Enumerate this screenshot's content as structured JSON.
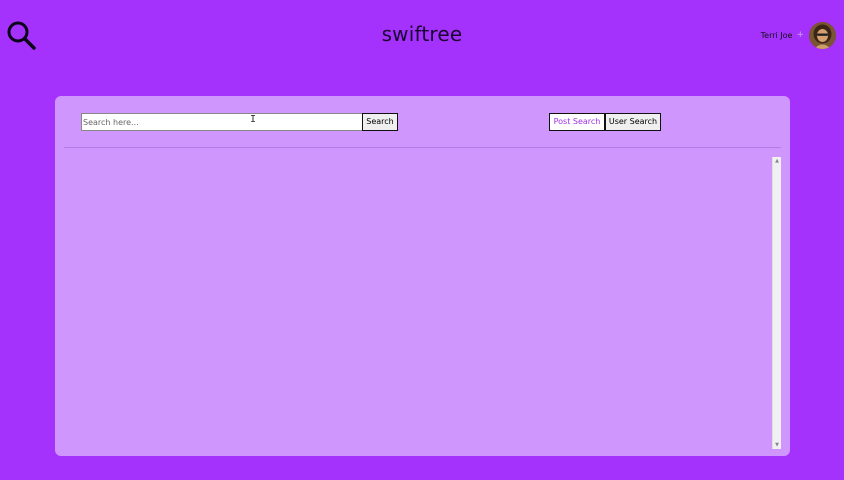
{
  "header": {
    "logo_icon": "magnifier-icon",
    "brand": "swiftree",
    "user": {
      "name": "Terri Joe",
      "badge_icon": "plus-icon",
      "badge_glyph": "+",
      "avatar": "user-avatar"
    }
  },
  "search": {
    "placeholder": "Search here...",
    "value": "",
    "button_label": "Search",
    "cursor_glyph": "I"
  },
  "toggles": {
    "post_search_label": "Post Search",
    "user_search_label": "User Search",
    "active": "post"
  },
  "scrollbar": {
    "up_glyph": "▲",
    "down_glyph": "▼"
  },
  "colors": {
    "page_background": "#a531fd",
    "panel_background": "#cf96fd",
    "active_toggle_text": "#9b30e8"
  }
}
